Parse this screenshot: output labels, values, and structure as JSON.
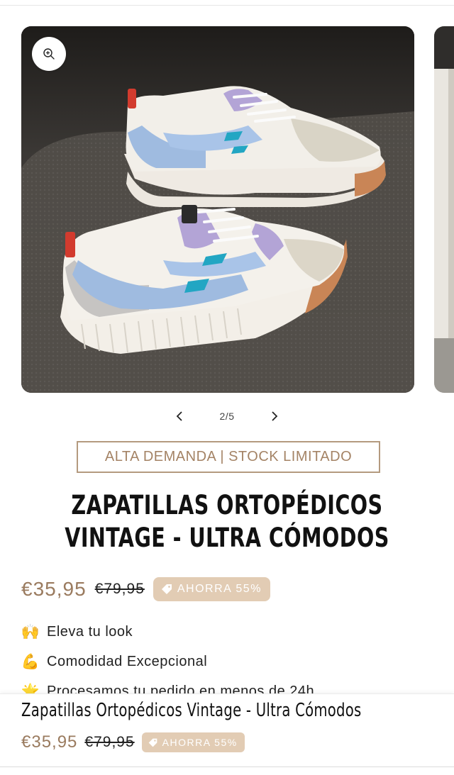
{
  "gallery": {
    "counter": "2/5",
    "zoom_icon": "zoom-in-icon",
    "prev_icon": "chevron-left-icon",
    "next_icon": "chevron-right-icon"
  },
  "badge": {
    "label": "ALTA DEMANDA | STOCK LIMITADO",
    "color": "#a48365"
  },
  "product": {
    "title": "ZAPATILLAS ORTOPÉDICOS VINTAGE - ULTRA CÓMODOS",
    "price": "€35,95",
    "compare_price": "€79,95",
    "save_label": "AHORRA 55%",
    "price_color": "#9a7b5f",
    "save_bg": "#e2ccb4"
  },
  "features": [
    {
      "icon": "raising-hands-icon",
      "emoji": "🙌",
      "text": "Eleva tu look"
    },
    {
      "icon": "flexed-biceps-icon",
      "emoji": "💪",
      "text": "Comodidad Excepcional"
    },
    {
      "icon": "glowing-star-icon",
      "emoji": "🌟",
      "text": "Procesamos tu pedido en menos de 24h"
    }
  ],
  "sticky": {
    "title": "Zapatillas Ortopédicos Vintage - Ultra Cómodos",
    "price": "€35,95",
    "compare_price": "€79,95",
    "save_label": "AHORRA 55%"
  }
}
